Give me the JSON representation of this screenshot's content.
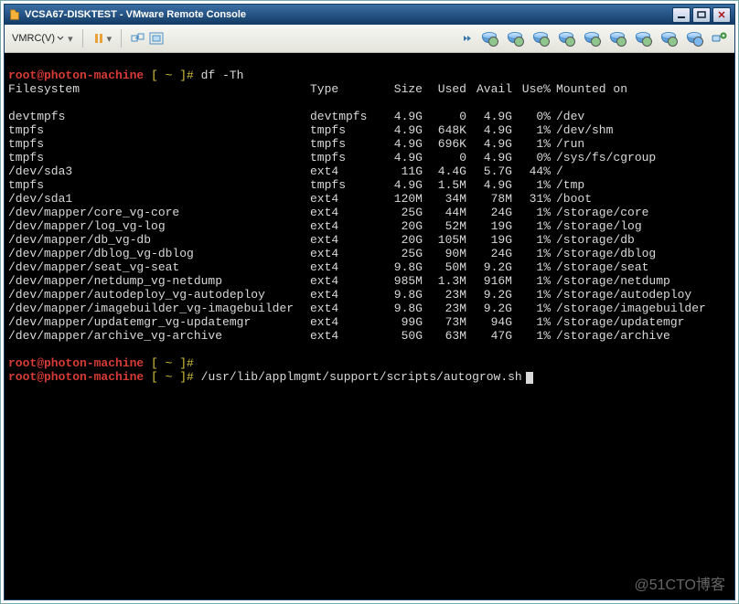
{
  "titlebar": {
    "title": "VCSA67-DISKTEST - VMware Remote Console"
  },
  "toolbar": {
    "vmrc_label": "VMRC(V)"
  },
  "watermark": "@51CTO博客",
  "terminal": {
    "prompt": {
      "user": "root@photon-machine",
      "path": "[ ~ ]#"
    },
    "commands": [
      "df -Th",
      "/usr/lib/applmgmt/support/scripts/autogrow.sh"
    ],
    "headers": {
      "fs": "Filesystem",
      "type": "Type",
      "size": "Size",
      "used": "Used",
      "avail": "Avail",
      "usep": "Use%",
      "mnt": "Mounted on"
    },
    "rows": [
      {
        "fs": "devtmpfs",
        "type": "devtmpfs",
        "size": "4.9G",
        "used": "0",
        "avail": "4.9G",
        "usep": "0%",
        "mnt": "/dev"
      },
      {
        "fs": "tmpfs",
        "type": "tmpfs",
        "size": "4.9G",
        "used": "648K",
        "avail": "4.9G",
        "usep": "1%",
        "mnt": "/dev/shm"
      },
      {
        "fs": "tmpfs",
        "type": "tmpfs",
        "size": "4.9G",
        "used": "696K",
        "avail": "4.9G",
        "usep": "1%",
        "mnt": "/run"
      },
      {
        "fs": "tmpfs",
        "type": "tmpfs",
        "size": "4.9G",
        "used": "0",
        "avail": "4.9G",
        "usep": "0%",
        "mnt": "/sys/fs/cgroup"
      },
      {
        "fs": "/dev/sda3",
        "type": "ext4",
        "size": "11G",
        "used": "4.4G",
        "avail": "5.7G",
        "usep": "44%",
        "mnt": "/"
      },
      {
        "fs": "tmpfs",
        "type": "tmpfs",
        "size": "4.9G",
        "used": "1.5M",
        "avail": "4.9G",
        "usep": "1%",
        "mnt": "/tmp"
      },
      {
        "fs": "/dev/sda1",
        "type": "ext4",
        "size": "120M",
        "used": "34M",
        "avail": "78M",
        "usep": "31%",
        "mnt": "/boot"
      },
      {
        "fs": "/dev/mapper/core_vg-core",
        "type": "ext4",
        "size": "25G",
        "used": "44M",
        "avail": "24G",
        "usep": "1%",
        "mnt": "/storage/core"
      },
      {
        "fs": "/dev/mapper/log_vg-log",
        "type": "ext4",
        "size": "20G",
        "used": "52M",
        "avail": "19G",
        "usep": "1%",
        "mnt": "/storage/log"
      },
      {
        "fs": "/dev/mapper/db_vg-db",
        "type": "ext4",
        "size": "20G",
        "used": "105M",
        "avail": "19G",
        "usep": "1%",
        "mnt": "/storage/db"
      },
      {
        "fs": "/dev/mapper/dblog_vg-dblog",
        "type": "ext4",
        "size": "25G",
        "used": "90M",
        "avail": "24G",
        "usep": "1%",
        "mnt": "/storage/dblog"
      },
      {
        "fs": "/dev/mapper/seat_vg-seat",
        "type": "ext4",
        "size": "9.8G",
        "used": "50M",
        "avail": "9.2G",
        "usep": "1%",
        "mnt": "/storage/seat"
      },
      {
        "fs": "/dev/mapper/netdump_vg-netdump",
        "type": "ext4",
        "size": "985M",
        "used": "1.3M",
        "avail": "916M",
        "usep": "1%",
        "mnt": "/storage/netdump"
      },
      {
        "fs": "/dev/mapper/autodeploy_vg-autodeploy",
        "type": "ext4",
        "size": "9.8G",
        "used": "23M",
        "avail": "9.2G",
        "usep": "1%",
        "mnt": "/storage/autodeploy"
      },
      {
        "fs": "/dev/mapper/imagebuilder_vg-imagebuilder",
        "type": "ext4",
        "size": "9.8G",
        "used": "23M",
        "avail": "9.2G",
        "usep": "1%",
        "mnt": "/storage/imagebuilder"
      },
      {
        "fs": "/dev/mapper/updatemgr_vg-updatemgr",
        "type": "ext4",
        "size": "99G",
        "used": "73M",
        "avail": "94G",
        "usep": "1%",
        "mnt": "/storage/updatemgr"
      },
      {
        "fs": "/dev/mapper/archive_vg-archive",
        "type": "ext4",
        "size": "50G",
        "used": "63M",
        "avail": "47G",
        "usep": "1%",
        "mnt": "/storage/archive"
      }
    ]
  }
}
